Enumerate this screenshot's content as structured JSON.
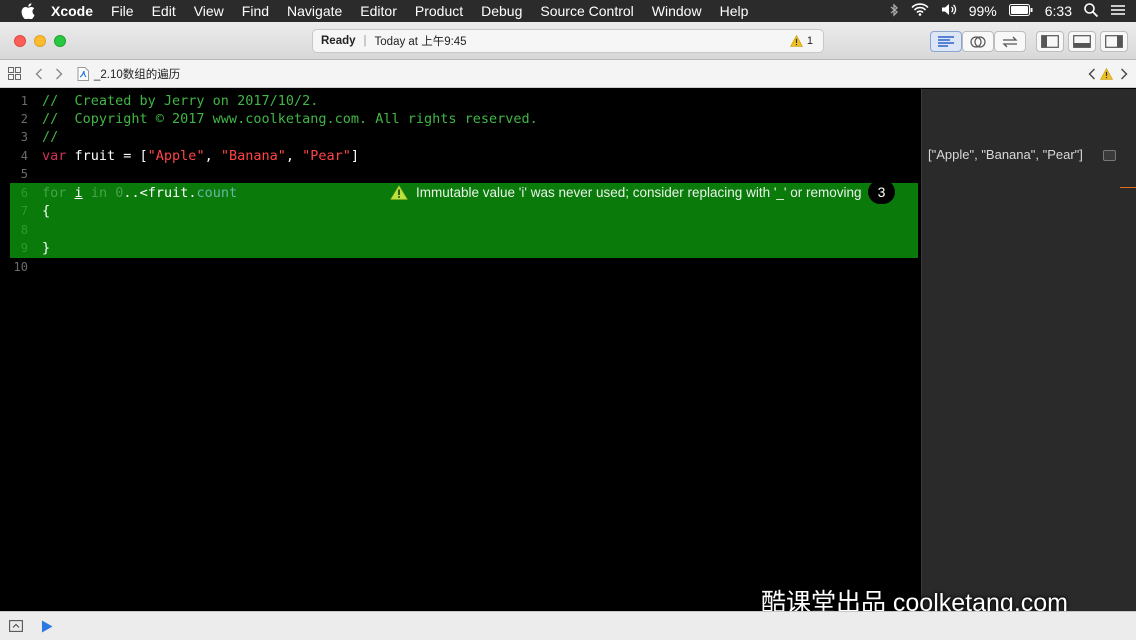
{
  "menubar": {
    "app": "Xcode",
    "items": [
      "File",
      "Edit",
      "View",
      "Find",
      "Navigate",
      "Editor",
      "Product",
      "Debug",
      "Source Control",
      "Window",
      "Help"
    ],
    "battery": "99%",
    "time": "6:33"
  },
  "toolbar": {
    "status": "Ready",
    "timestamp": "Today at 上午9:45",
    "warning_count": "1"
  },
  "jumpbar": {
    "filename": "_2.10数组的遍历"
  },
  "editor": {
    "line_numbers": [
      "1",
      "2",
      "3",
      "4",
      "5",
      "6",
      "7",
      "8",
      "9",
      "10"
    ],
    "line1": "//  Created by Jerry on 2017/10/2.",
    "line2": "//  Copyright © 2017 www.coolketang.com. All rights reserved.",
    "line4": {
      "var": "var",
      "ident": " fruit = [",
      "s1": "\"Apple\"",
      "c1": ", ",
      "s2": "\"Banana\"",
      "c2": ", ",
      "s3": "\"Pear\"",
      "end": "]"
    },
    "line6": {
      "for": "for",
      "sp1": " ",
      "i": "i",
      "sp2": " ",
      "in": "in",
      "sp3": " ",
      "zero": "0",
      "range": "..<fruit.",
      "count": "count"
    },
    "line7": "{",
    "line9": "}",
    "warning_message": "Immutable value 'i' was never used; consider replacing with '_' or removing",
    "issue_count": "3"
  },
  "results": {
    "line4_result": "[\"Apple\", \"Banana\", \"Pear\"]"
  },
  "watermark": "酷课堂出品 coolketang.com",
  "colors": {
    "highlight": "#0a7a0a",
    "comment": "#41b645",
    "keyword": "#d2315c",
    "string": "#ff4444",
    "number": "#786dc4"
  }
}
